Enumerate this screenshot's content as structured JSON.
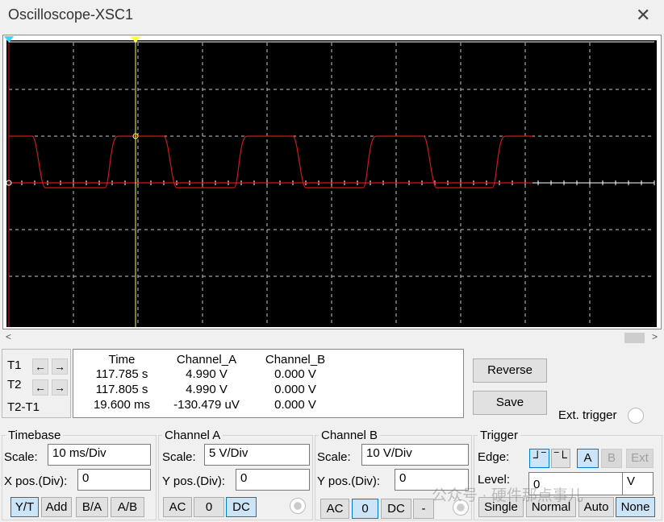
{
  "window": {
    "title": "Oscilloscope-XSC1",
    "close": "✕"
  },
  "cursors": {
    "t1": "T1",
    "t2": "T2",
    "diff": "T2-T1"
  },
  "readout": {
    "headers": [
      "Time",
      "Channel_A",
      "Channel_B"
    ],
    "rows": [
      [
        "117.785 s",
        "4.990 V",
        "0.000 V"
      ],
      [
        "117.805 s",
        "4.990 V",
        "0.000 V"
      ],
      [
        "19.600 ms",
        "-130.479 uV",
        "0.000 V"
      ]
    ]
  },
  "buttons": {
    "reverse": "Reverse",
    "save": "Save",
    "ext_trigger": "Ext. trigger"
  },
  "timebase": {
    "title": "Timebase",
    "scale_label": "Scale:",
    "scale": "10 ms/Div",
    "xpos_label": "X pos.(Div):",
    "xpos": "0",
    "modes": [
      "Y/T",
      "Add",
      "B/A",
      "A/B"
    ]
  },
  "channel_a": {
    "title": "Channel A",
    "scale_label": "Scale:",
    "scale": "5  V/Div",
    "ypos_label": "Y pos.(Div):",
    "ypos": "0",
    "coupling": [
      "AC",
      "0",
      "DC"
    ]
  },
  "channel_b": {
    "title": "Channel B",
    "scale_label": "Scale:",
    "scale": "10  V/Div",
    "ypos_label": "Y pos.(Div):",
    "ypos": "0",
    "coupling": [
      "AC",
      "0",
      "DC",
      "-"
    ]
  },
  "trigger": {
    "title": "Trigger",
    "edge_label": "Edge:",
    "sources": [
      "A",
      "B",
      "Ext"
    ],
    "level_label": "Level:",
    "level": "0",
    "level_unit": "V",
    "modes": [
      "Single",
      "Normal",
      "Auto",
      "None"
    ]
  },
  "watermark": "公众号 · 硬件那点事儿",
  "colors": {
    "trace_a": "#d01818",
    "cursor_t2": "#ffff40",
    "cursor_t1": "#40d0ff",
    "grid": "#c8c8c8"
  }
}
